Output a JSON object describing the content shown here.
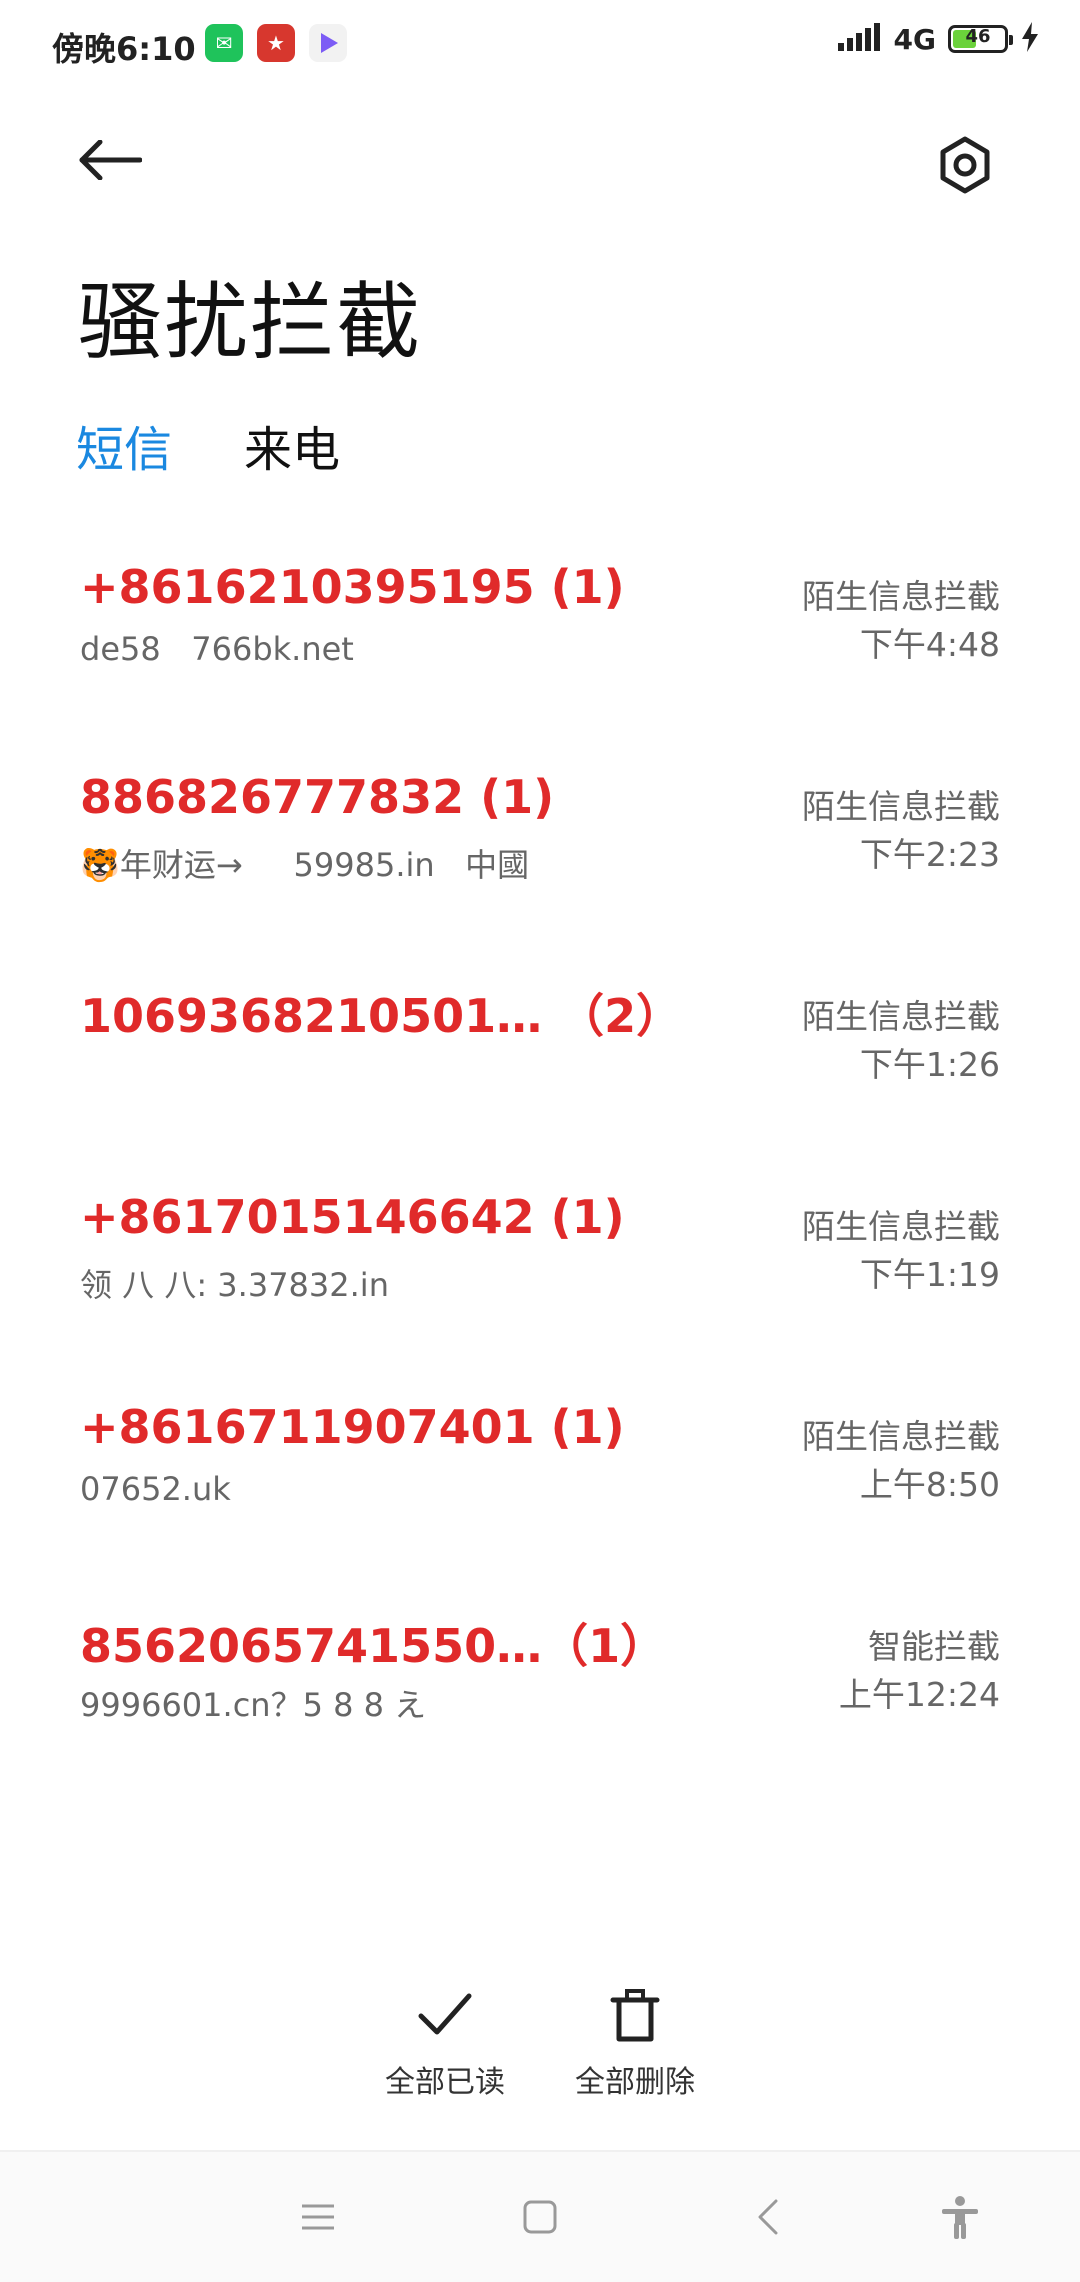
{
  "status_bar": {
    "time": "傍晚6:10",
    "network": "4G",
    "battery_level": "46",
    "battery_fraction": 0.46,
    "apps": [
      "wechat-icon",
      "app-icon-red",
      "video-app-icon"
    ]
  },
  "header": {
    "title": "骚扰拦截"
  },
  "tabs": [
    {
      "label": "短信",
      "active": true
    },
    {
      "label": "来电",
      "active": false
    }
  ],
  "messages": [
    {
      "number": "+8616210395195 (1)",
      "preview": "de58   766bk.net",
      "type": "陌生信息拦截",
      "time": "下午4:48"
    },
    {
      "number": "886826777832 (1)",
      "preview": "🐯年财运→     59985.in   中國",
      "type": "陌生信息拦截",
      "time": "下午2:23"
    },
    {
      "number": "1069368210501… （2）",
      "preview": "",
      "type": "陌生信息拦截",
      "time": "下午1:26"
    },
    {
      "number": "+8617015146642 (1)",
      "preview": "领 八 八: 3.37832.in",
      "type": "陌生信息拦截",
      "time": "下午1:19"
    },
    {
      "number": "+8616711907401 (1)",
      "preview": "07652.uk",
      "type": "陌生信息拦截",
      "time": "上午8:50"
    },
    {
      "number": "8562065741550…（1）",
      "preview": "9996601.cn？5 8 8 え",
      "type": "智能拦截",
      "time": "上午12:24"
    }
  ],
  "actions": {
    "mark_all_read": "全部已读",
    "delete_all": "全部删除"
  },
  "colors": {
    "accent": "#1a88e0",
    "number": "#e02a2a",
    "secondary_text": "#666666"
  }
}
